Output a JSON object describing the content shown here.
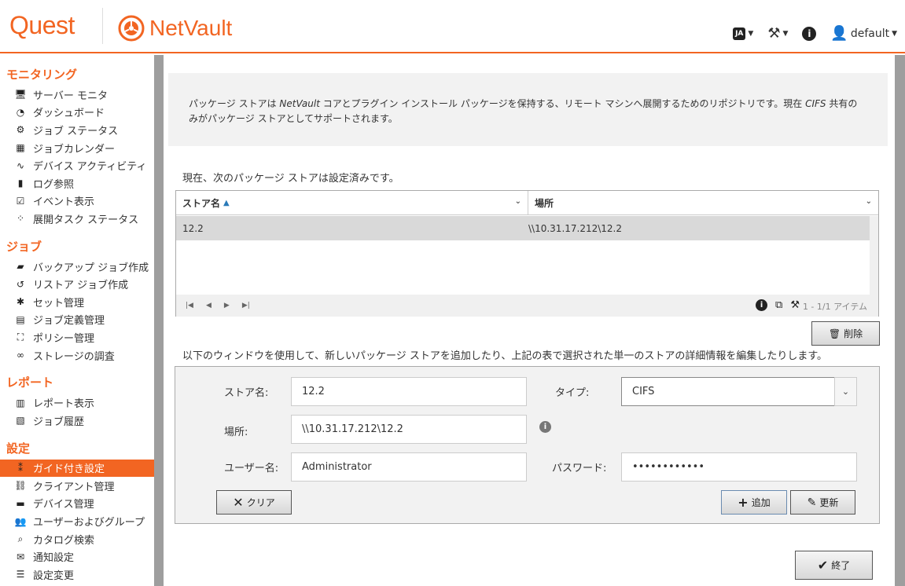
{
  "header": {
    "brand": "Quest",
    "product": "NetVault",
    "lang_label": "JA",
    "user": "default"
  },
  "sidebar": {
    "sections": [
      {
        "title": "モニタリング",
        "items": [
          {
            "label": "サーバー モニタ",
            "icon": "monitor-icon",
            "glyph": "🖥"
          },
          {
            "label": "ダッシュボード",
            "icon": "dashboard-icon",
            "glyph": "◔"
          },
          {
            "label": "ジョブ ステータス",
            "icon": "job-status-icon",
            "glyph": "⚙"
          },
          {
            "label": "ジョブカレンダー",
            "icon": "calendar-icon",
            "glyph": "▦"
          },
          {
            "label": "デバイス アクティビティ",
            "icon": "activity-icon",
            "glyph": "∿"
          },
          {
            "label": "ログ参照",
            "icon": "log-icon",
            "glyph": "▮"
          },
          {
            "label": "イベント表示",
            "icon": "event-icon",
            "glyph": "☑"
          },
          {
            "label": "展開タスク ステータス",
            "icon": "deploy-status-icon",
            "glyph": "⁘"
          }
        ]
      },
      {
        "title": "ジョブ",
        "items": [
          {
            "label": "バックアップ ジョブ作成",
            "icon": "backup-icon",
            "glyph": "▰"
          },
          {
            "label": "リストア ジョブ作成",
            "icon": "restore-icon",
            "glyph": "↺"
          },
          {
            "label": "セット管理",
            "icon": "sets-icon",
            "glyph": "✱"
          },
          {
            "label": "ジョブ定義管理",
            "icon": "job-def-icon",
            "glyph": "▤"
          },
          {
            "label": "ポリシー管理",
            "icon": "policy-icon",
            "glyph": "⛶"
          },
          {
            "label": "ストレージの調査",
            "icon": "binoculars-icon",
            "glyph": "∞"
          }
        ]
      },
      {
        "title": "レポート",
        "items": [
          {
            "label": "レポート表示",
            "icon": "report-icon",
            "glyph": "▥"
          },
          {
            "label": "ジョブ履歴",
            "icon": "history-icon",
            "glyph": "▧"
          }
        ]
      },
      {
        "title": "設定",
        "items": [
          {
            "label": "ガイド付き設定",
            "icon": "footsteps-icon",
            "glyph": "⁑",
            "active": true
          },
          {
            "label": "クライアント管理",
            "icon": "client-icon",
            "glyph": "⛓"
          },
          {
            "label": "デバイス管理",
            "icon": "device-icon",
            "glyph": "▬"
          },
          {
            "label": "ユーザーおよびグループ",
            "icon": "users-icon",
            "glyph": "👥"
          },
          {
            "label": "カタログ検索",
            "icon": "catalog-icon",
            "glyph": "⌕"
          },
          {
            "label": "通知設定",
            "icon": "notify-icon",
            "glyph": "✉"
          },
          {
            "label": "設定変更",
            "icon": "settings-icon",
            "glyph": "☰"
          }
        ]
      }
    ]
  },
  "info": {
    "text_1": "パッケージ ストアは ",
    "text_product": "NetVault",
    "text_2": " コアとプラグイン インストール パッケージを保持する、リモート マシンへ展開するためのリポジトリです。現在 ",
    "text_cifs": "CIFS",
    "text_3": " 共有のみがパッケージ ストアとしてサポートされます。"
  },
  "current_label": "現在、次のパッケージ ストアは設定済みです。",
  "table": {
    "columns": [
      "ストア名",
      "場所"
    ],
    "rows": [
      {
        "name": "12.2",
        "location": "\\\\10.31.17.212\\12.2"
      }
    ],
    "count": "1 - 1/1 アイテム"
  },
  "delete_label": "削除",
  "below_label": "以下のウィンドウを使用して、新しいパッケージ ストアを追加したり、上記の表で選択された単一のストアの詳細情報を編集したりします。",
  "form": {
    "store_name_label": "ストア名:",
    "store_name_value": "12.2",
    "type_label": "タイプ:",
    "type_value": "CIFS",
    "location_label": "場所:",
    "location_value": "\\\\10.31.17.212\\12.2",
    "username_label": "ユーザー名:",
    "username_value": "Administrator",
    "password_label": "パスワード:",
    "password_value": "••••••••••••",
    "clear_label": "クリア",
    "add_label": "追加",
    "update_label": "更新"
  },
  "finish_label": "終了"
}
